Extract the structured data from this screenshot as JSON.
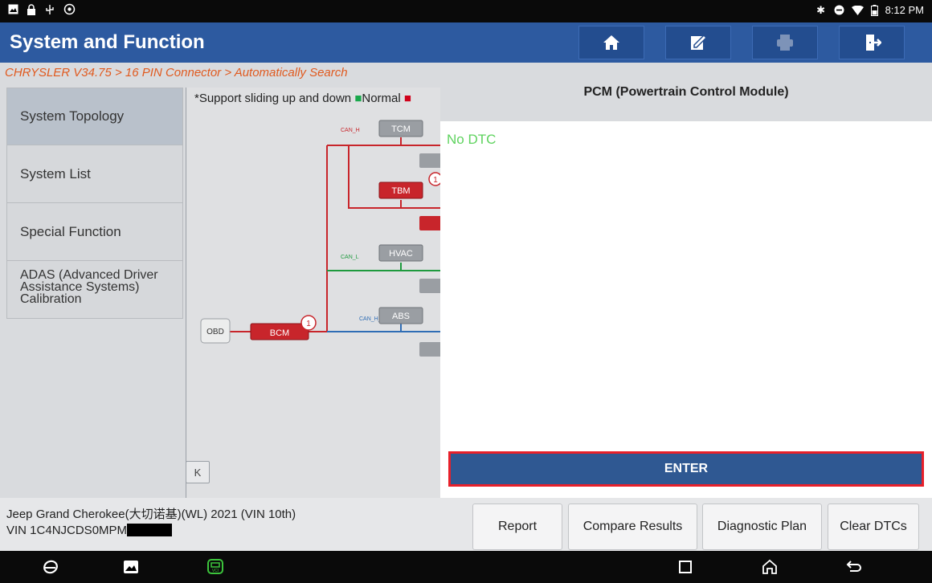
{
  "status_bar": {
    "time": "8:12 PM",
    "left_icons": [
      "image-notification-icon",
      "lock-notification-icon",
      "usb-icon",
      "settings-cog-icon"
    ],
    "right_icons": [
      "bluetooth-icon",
      "do-not-disturb-icon",
      "wifi-icon",
      "battery-icon"
    ]
  },
  "header": {
    "title": "System and Function",
    "buttons": [
      "home-icon",
      "edit-icon",
      "print-icon",
      "exit-icon"
    ]
  },
  "breadcrumb": "CHRYSLER V34.75 > 16 PIN Connector > Automatically Search",
  "sidebar": {
    "items": [
      {
        "label": "System Topology",
        "active": true
      },
      {
        "label": "System List",
        "active": false
      },
      {
        "label": "Special Function",
        "active": false
      },
      {
        "label": "ADAS (Advanced Driver Assistance Systems) Calibration",
        "active": false
      }
    ]
  },
  "topology": {
    "hint_prefix": "*Support sliding up and down ",
    "hint_normal": "Normal",
    "nodes": {
      "obd": "OBD",
      "bcm": "BCM",
      "bcm_badge": "1",
      "tcm": "TCM",
      "tbm": "TBM",
      "tbm_badge": "1",
      "hvac": "HVAC",
      "abs": "ABS"
    },
    "bus_labels": {
      "can_h": "CAN_H",
      "can_l": "CAN_L",
      "can_h_2": "CAN_H_2"
    },
    "colors": {
      "bus_red": "#c8252b",
      "bus_green": "#1e9a3e",
      "bus_blue": "#2f6db5",
      "node_gray": "#9a9ea3",
      "node_red": "#c8252b"
    }
  },
  "collapse_button": "K",
  "panel": {
    "title": "PCM (Powertrain Control Module)",
    "status": "No DTC",
    "enter_label": "ENTER"
  },
  "footer": {
    "vehicle": "Jeep Grand Cherokee(大切诺基)(WL) 2021 (VIN 10th)",
    "vin": "VIN 1C4NJCDS0MPM",
    "buttons": {
      "report": "Report",
      "compare": "Compare Results",
      "plan": "Diagnostic Plan",
      "clear": "Clear DTCs"
    }
  },
  "navbar": {
    "icons": [
      "browser-icon",
      "gallery-icon",
      "vci-icon",
      "recents-icon",
      "home-nav-icon",
      "back-icon"
    ],
    "vci_color": "#3cc43c"
  },
  "colors": {
    "header_blue": "#2d5aa0",
    "breadcrumb_orange": "#e05a1f",
    "no_dtc_green": "#5fd35f",
    "highlight_red": "#e8202a"
  }
}
